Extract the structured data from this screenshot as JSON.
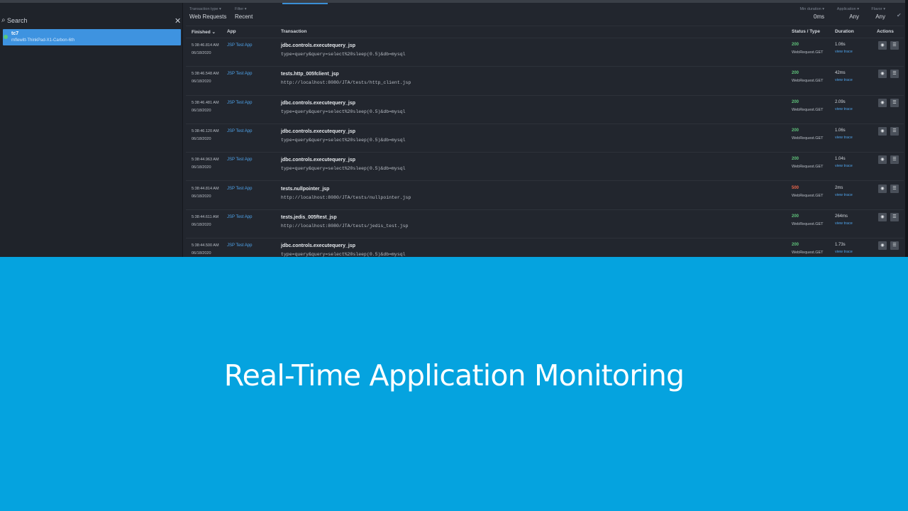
{
  "sidebar": {
    "search_placeholder": "Search",
    "clear_icon": "close-icon",
    "host": {
      "name": "tc7",
      "sub": "mflewitt-ThinkPad-X1-Carbon-6th"
    }
  },
  "filters": [
    {
      "label": "Transaction type ▾",
      "value": "Web Requests"
    },
    {
      "label": "Filter ▾",
      "value": "Recent"
    },
    {
      "label": "Min duration ▾",
      "value": "0ms"
    },
    {
      "label": "Application ▾",
      "value": "Any"
    },
    {
      "label": "Flavor ▾",
      "value": "Any"
    }
  ],
  "table": {
    "headers": [
      "Finished ⌄",
      "App",
      "Transaction",
      "Status / Type",
      "Duration",
      "Actions"
    ],
    "rows": [
      {
        "time": "5:38:46.814 AM",
        "date": "06/18/2020",
        "app": "JSP Test App",
        "name": "jdbc.controls.executequery_jsp",
        "detail": "type=query&query=select%20sleep(0.5)&db=mysql",
        "status": "200",
        "type": "WebRequest.GET",
        "duration": "1.06s",
        "trace": "view trace"
      },
      {
        "time": "5:38:46.548 AM",
        "date": "06/18/2020",
        "app": "JSP Test App",
        "name": "tests.http_005fclient_jsp",
        "detail": "http://localhost:8080/JTA/tests/http_client.jsp",
        "status": "200",
        "type": "WebRequest.GET",
        "duration": "42ms",
        "trace": "view trace"
      },
      {
        "time": "5:38:46.481 AM",
        "date": "06/18/2020",
        "app": "JSP Test App",
        "name": "jdbc.controls.executequery_jsp",
        "detail": "type=query&query=select%20sleep(0.5)&db=mysql",
        "status": "200",
        "type": "WebRequest.GET",
        "duration": "2.09s",
        "trace": "view trace"
      },
      {
        "time": "5:38:46.120 AM",
        "date": "06/18/2020",
        "app": "JSP Test App",
        "name": "jdbc.controls.executequery_jsp",
        "detail": "type=query&query=select%20sleep(0.5)&db=mysql",
        "status": "200",
        "type": "WebRequest.GET",
        "duration": "1.06s",
        "trace": "view trace"
      },
      {
        "time": "5:38:44.963 AM",
        "date": "06/18/2020",
        "app": "JSP Test App",
        "name": "jdbc.controls.executequery_jsp",
        "detail": "type=query&query=select%20sleep(0.5)&db=mysql",
        "status": "200",
        "type": "WebRequest.GET",
        "duration": "1.04s",
        "trace": "view trace"
      },
      {
        "time": "5:38:44.814 AM",
        "date": "06/18/2020",
        "app": "JSP Test App",
        "name": "tests.nullpointer_jsp",
        "detail": "http://localhost:8080/JTA/tests/nullpointer.jsp",
        "status": "500",
        "type": "WebRequest.GET",
        "duration": "2ms",
        "trace": "view trace"
      },
      {
        "time": "5:38:44.611 AM",
        "date": "06/18/2020",
        "app": "JSP Test App",
        "name": "tests.jedis_005ftest_jsp",
        "detail": "http://localhost:8080/JTA/tests/jedis_test.jsp",
        "status": "200",
        "type": "WebRequest.GET",
        "duration": "264ms",
        "trace": "view trace"
      },
      {
        "time": "5:38:44.500 AM",
        "date": "06/18/2020",
        "app": "JSP Test App",
        "name": "jdbc.controls.executequery_jsp",
        "detail": "type=query&query=select%20sleep(0.5)&db=mysql",
        "status": "200",
        "type": "WebRequest.GET",
        "duration": "1.73s",
        "trace": "view trace"
      }
    ]
  },
  "colors": {
    "status_ok": "#5fc27a",
    "status_error": "#e8644a",
    "link": "#4fa3ea",
    "banner": "#05a3df"
  },
  "icons": {
    "view": "eye-icon",
    "more": "menu-icon",
    "search": "search-icon",
    "apply": "check-icon"
  },
  "banner": {
    "title": "Real-Time Application Monitoring"
  }
}
